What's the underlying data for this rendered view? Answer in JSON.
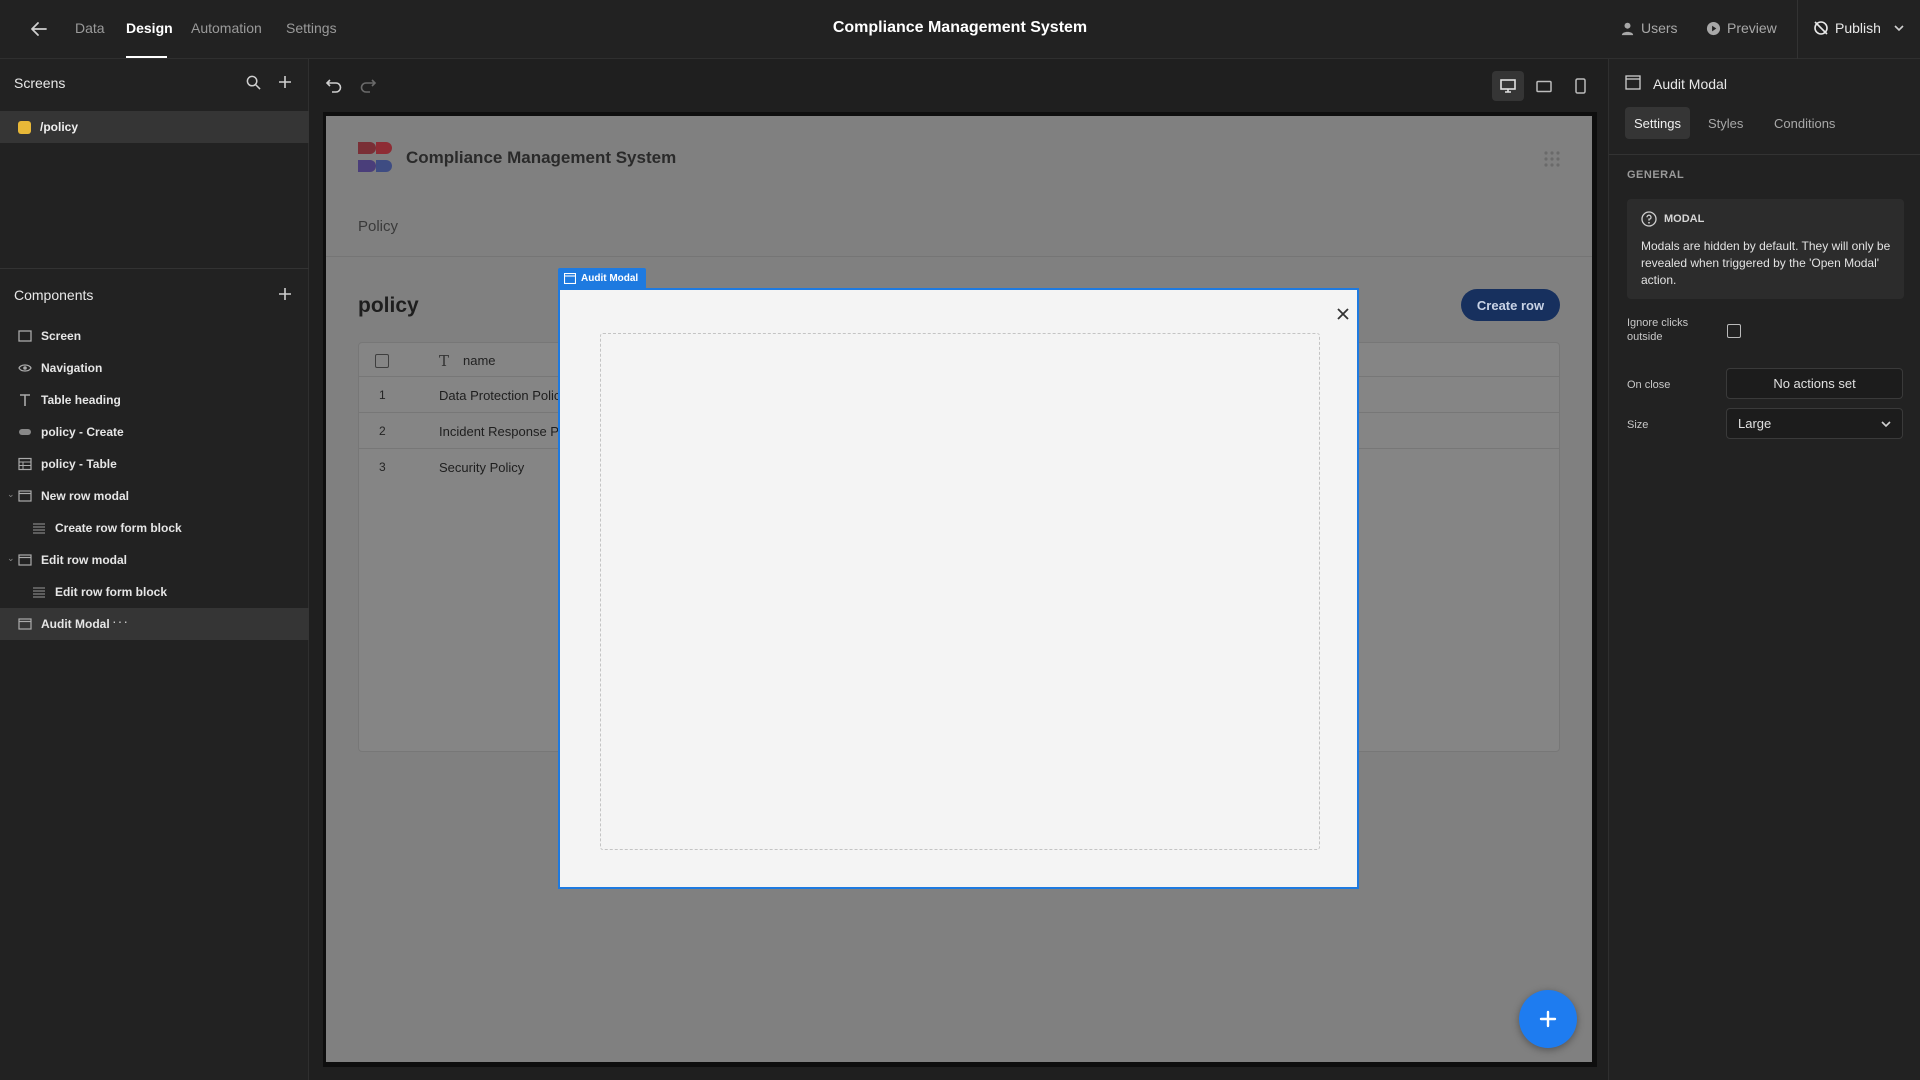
{
  "topbar": {
    "tabs": [
      {
        "label": "Data"
      },
      {
        "label": "Design",
        "active": true
      },
      {
        "label": "Automation"
      },
      {
        "label": "Settings"
      }
    ],
    "app_title": "Compliance Management System",
    "users_label": "Users",
    "preview_label": "Preview",
    "publish_label": "Publish"
  },
  "left_panel": {
    "screens_title": "Screens",
    "screens": [
      {
        "label": "/policy",
        "color": "#e8b838"
      }
    ],
    "components_title": "Components",
    "components": [
      {
        "label": "Screen",
        "icon": "screen-icon"
      },
      {
        "label": "Navigation",
        "icon": "eye-icon"
      },
      {
        "label": "Table heading",
        "icon": "text-icon"
      },
      {
        "label": "policy - Create",
        "icon": "button-icon"
      },
      {
        "label": "policy - Table",
        "icon": "table-icon"
      },
      {
        "label": "New row modal",
        "icon": "modal-icon",
        "expanded": true
      },
      {
        "label": "Create row form block",
        "icon": "form-icon"
      },
      {
        "label": "Edit row modal",
        "icon": "modal-icon",
        "expanded": true
      },
      {
        "label": "Edit row form block",
        "icon": "form-icon"
      },
      {
        "label": "Audit Modal",
        "icon": "modal-icon",
        "selected": true
      }
    ]
  },
  "canvas": {
    "app_brand": "Compliance Management System",
    "nav_link": "Policy",
    "page_heading": "policy",
    "create_row_label": "Create row",
    "table": {
      "columns": [
        "name"
      ],
      "rows": [
        {
          "num": "1",
          "name": "Data Protection Polic"
        },
        {
          "num": "2",
          "name": "Incident Response P"
        },
        {
          "num": "3",
          "name": "Security Policy"
        }
      ]
    },
    "modal_tag": "Audit Modal"
  },
  "right_panel": {
    "title": "Audit Modal",
    "tabs": [
      {
        "label": "Settings",
        "active": true
      },
      {
        "label": "Styles"
      },
      {
        "label": "Conditions"
      }
    ],
    "section": "GENERAL",
    "info_heading": "MODAL",
    "info_text": "Modals are hidden by default. They will only be revealed when triggered by the 'Open Modal' action.",
    "ignore_clicks_label": "Ignore clicks outside",
    "ignore_clicks_checked": false,
    "on_close_label": "On close",
    "on_close_value": "No actions set",
    "size_label": "Size",
    "size_value": "Large"
  },
  "colors": {
    "accent": "#1e7ae0",
    "fab": "#1e7cf0",
    "create_button": "#17305e"
  }
}
